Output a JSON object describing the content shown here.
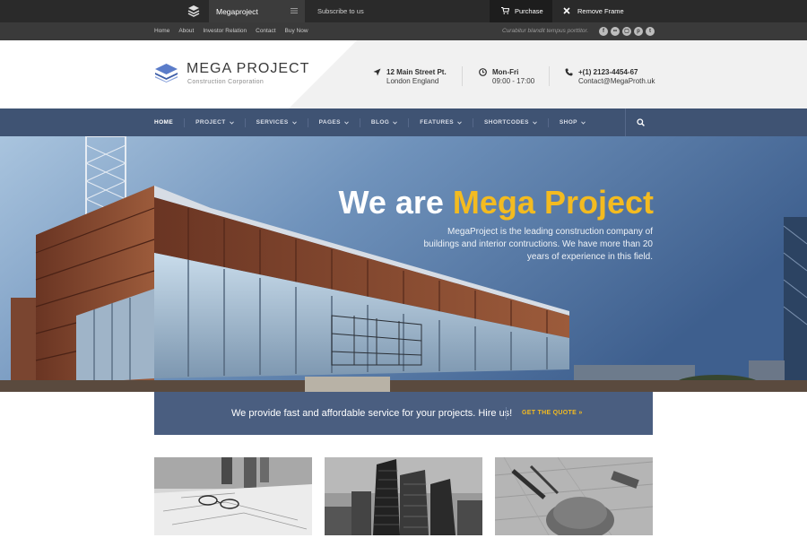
{
  "frame": {
    "site_select": "Megaproject",
    "subscribe": "Subscribe to us",
    "purchase": "Purchase",
    "remove_frame": "Remove Frame"
  },
  "topbar": {
    "links": [
      "Home",
      "About",
      "Investor Relation",
      "Contact",
      "Buy Now"
    ],
    "tagline": "Curabitur blandit tempus porttitor.",
    "social": [
      "facebook-icon",
      "flickr-icon",
      "instagram-icon",
      "pinterest-icon",
      "twitter-icon"
    ]
  },
  "header": {
    "logo_name": "MEGA PROJECT",
    "logo_sub": "Construction Corporation",
    "address_title": "12 Main Street Pt.",
    "address_sub": "London England",
    "hours_title": "Mon-Fri",
    "hours_sub": "09:00 - 17:00",
    "phone_title": "+(1) 2123-4454-67",
    "phone_sub": "Contact@MegaProth.uk"
  },
  "nav": {
    "items": [
      "HOME",
      "PROJECT",
      "SERVICES",
      "PAGES",
      "BLOG",
      "FEATURES",
      "SHORTCODES",
      "SHOP"
    ]
  },
  "hero": {
    "title_white": "We are ",
    "title_accent": "Mega Project",
    "text": "MegaProject is the leading construction company of buildings and interior contructions. We have more than 20 years of experience in this field."
  },
  "cta": {
    "text": "We provide fast and affordable service for your projects. Hire us!",
    "button": "GET THE QUOTE  »"
  },
  "colors": {
    "accent": "#f3bb20",
    "nav": "#3f5373",
    "cta": "#4a5e80"
  }
}
